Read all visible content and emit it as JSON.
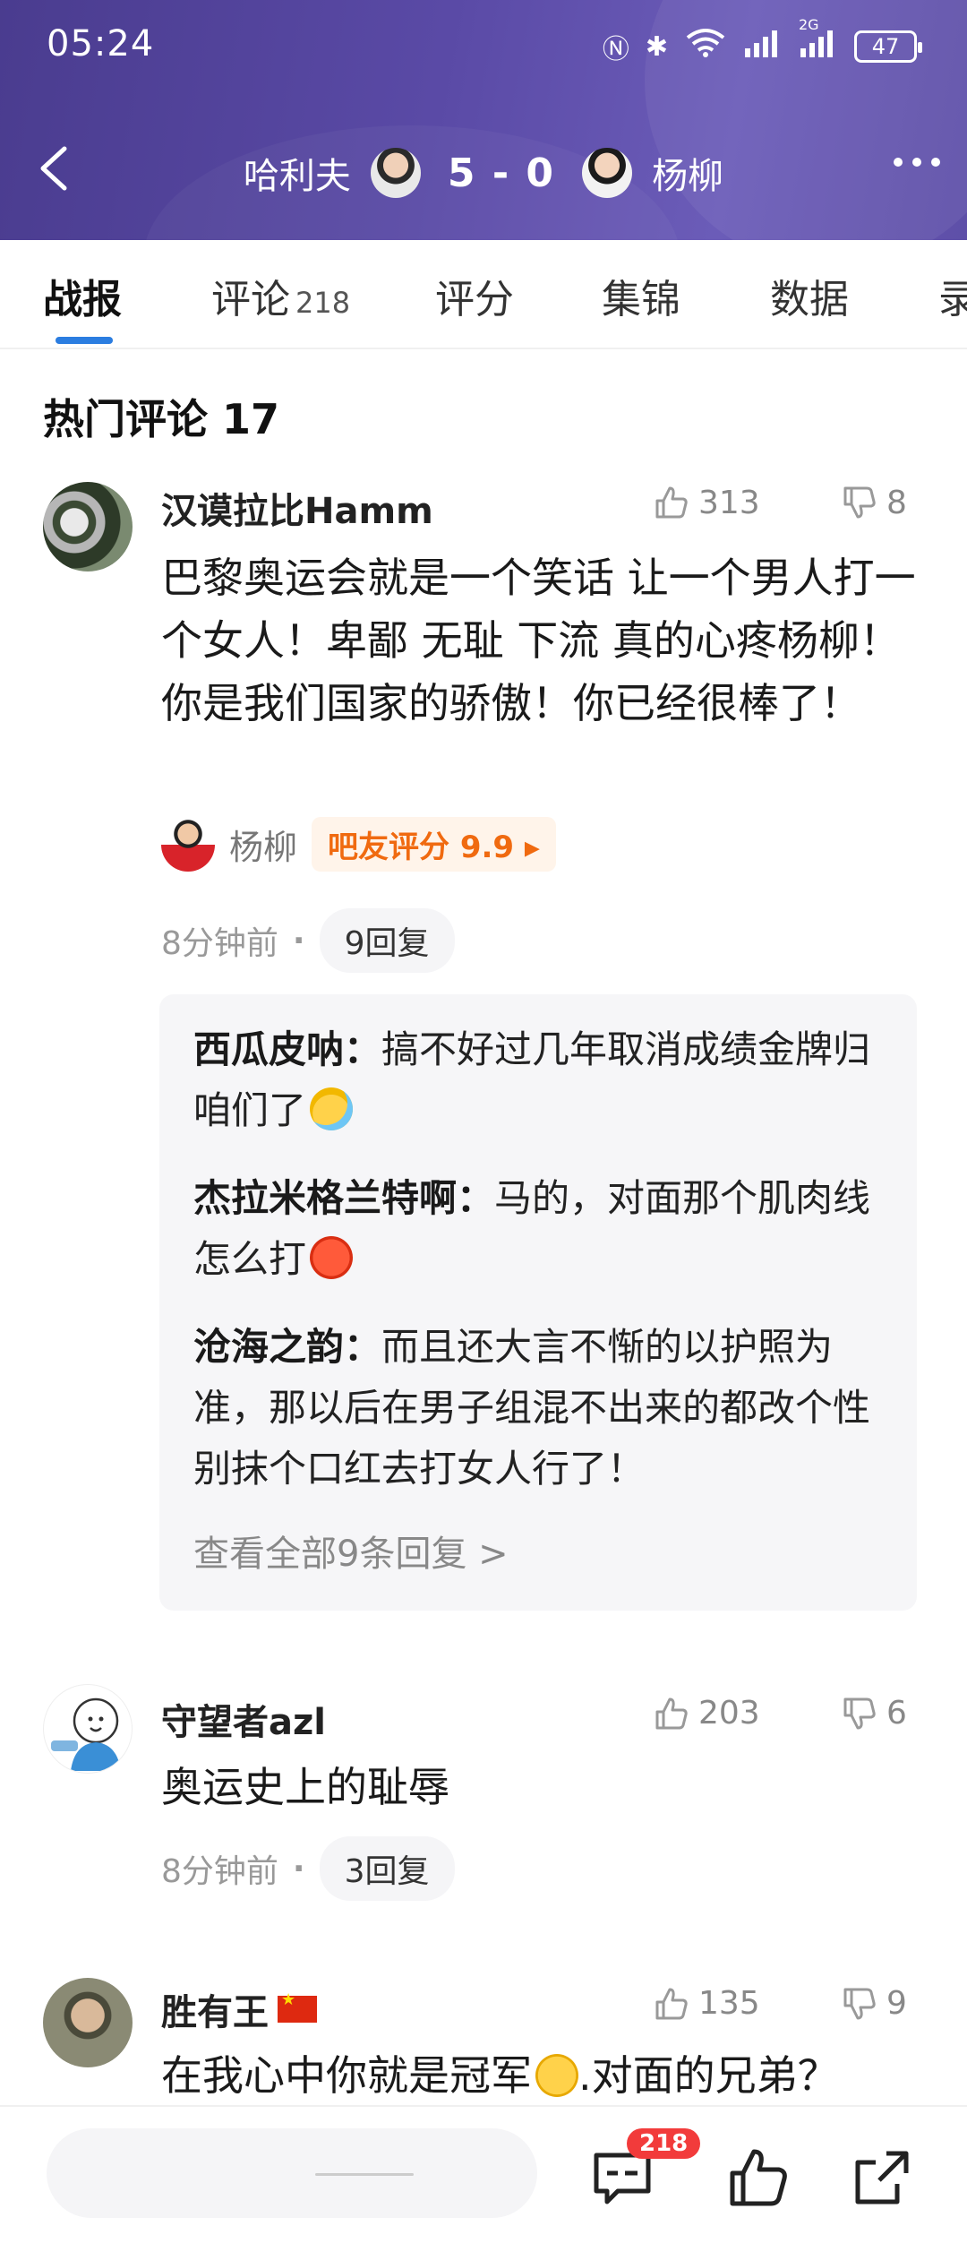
{
  "status_bar": {
    "time": "05:24",
    "battery": "47",
    "network": "2G"
  },
  "header": {
    "player_left": "哈利夫",
    "score": "5 - 0",
    "player_right": "杨柳"
  },
  "tabs": [
    {
      "label": "战报",
      "count": "",
      "active": true
    },
    {
      "label": "评论",
      "count": "218",
      "active": false
    },
    {
      "label": "评分",
      "count": "",
      "active": false
    },
    {
      "label": "集锦",
      "count": "",
      "active": false
    },
    {
      "label": "数据",
      "count": "",
      "active": false
    },
    {
      "label": "录",
      "count": "",
      "active": false
    }
  ],
  "section": {
    "title": "热门评论 17"
  },
  "comments": [
    {
      "user": "汉谟拉比Hamm",
      "likes": "313",
      "dislikes": "8",
      "text": "巴黎奥运会就是一个笑话 让一个男人打一个女人！卑鄙 无耻 下流 真的心疼杨柳！你是我们国家的骄傲！你已经很棒了！",
      "rating": {
        "player": "杨柳",
        "badge": "吧友评分 9.9 ▸"
      },
      "time": "8分钟前",
      "replies": "9回复",
      "sub_replies": [
        {
          "user": "西瓜皮呐：",
          "text": "搞不好过几年取消成绩金牌归咱们了"
        },
        {
          "user": "杰拉米格兰特啊：",
          "text": "马的，对面那个肌肉线怎么打"
        },
        {
          "user": "沧海之韵：",
          "text": "而且还大言不惭的以护照为准，那以后在男子组混不出来的都改个性别抹个口红去打女人行了！"
        }
      ],
      "view_all": "查看全部9条回复 >"
    },
    {
      "user": "守望者azl",
      "likes": "203",
      "dislikes": "6",
      "text": "奥运史上的耻辱",
      "time": "8分钟前",
      "replies": "3回复"
    },
    {
      "user": "胜有王",
      "likes": "135",
      "dislikes": "9",
      "text": "在我心中你就是冠军",
      "text_tail": ".对面的兄弟？"
    }
  ],
  "bottom_bar": {
    "comment_badge": "218"
  },
  "colors": {
    "header_bg": "#5a4aa6",
    "accent": "#2b7de0",
    "rating_orange": "#f06a10",
    "badge_red": "#f23b3b"
  }
}
